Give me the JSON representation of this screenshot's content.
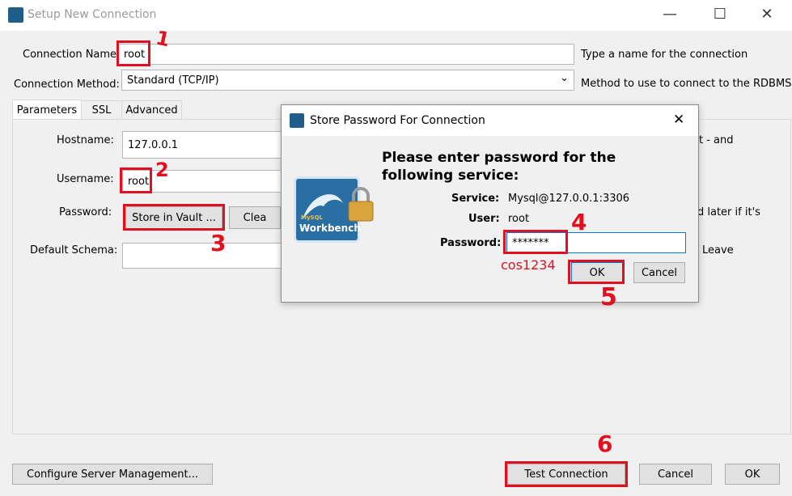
{
  "window": {
    "title": "Setup New Connection",
    "minimize": "—",
    "maximize": "☐",
    "close": "✕"
  },
  "form": {
    "connection_name_label": "Connection Name:",
    "connection_name_value": "root",
    "connection_name_hint": "Type a name for the connection",
    "connection_method_label": "Connection Method:",
    "connection_method_value": "Standard (TCP/IP)",
    "connection_method_hint": "Method to use to connect to the RDBMS"
  },
  "tabs": [
    {
      "label": "Parameters"
    },
    {
      "label": "SSL"
    },
    {
      "label": "Advanced"
    }
  ],
  "params": {
    "hostname_label": "Hostname:",
    "hostname_value": "127.0.0.1",
    "hostname_hint_fragment": "t - and",
    "username_label": "Username:",
    "username_value": "root",
    "password_label": "Password:",
    "store_vault_label": "Store in Vault ...",
    "clear_label": "Clea",
    "password_hint_fragment": "d later if it's",
    "default_schema_label": "Default Schema:",
    "schema_hint_fragment": "Leave"
  },
  "footer": {
    "configure_label": "Configure Server Management...",
    "test_label": "Test Connection",
    "cancel_label": "Cancel",
    "ok_label": "OK"
  },
  "dialog": {
    "title": "Store Password For Connection",
    "close": "✕",
    "heading": "Please enter password for the following service:",
    "service_label": "Service:",
    "service_value": "Mysql@127.0.0.1:3306",
    "user_label": "User:",
    "user_value": "root",
    "password_label": "Password:",
    "password_value": "*******",
    "ok_label": "OK",
    "cancel_label": "Cancel",
    "logo_small": "MySQL",
    "logo_text": "Workbench"
  },
  "annotations": {
    "step1": "1",
    "step2": "2",
    "step3": "3",
    "step4": "4",
    "step5": "5",
    "step6": "6",
    "password_note": "cos1234"
  },
  "colors": {
    "annotation_red": "#e01020",
    "accent_blue": "#0078d7"
  }
}
